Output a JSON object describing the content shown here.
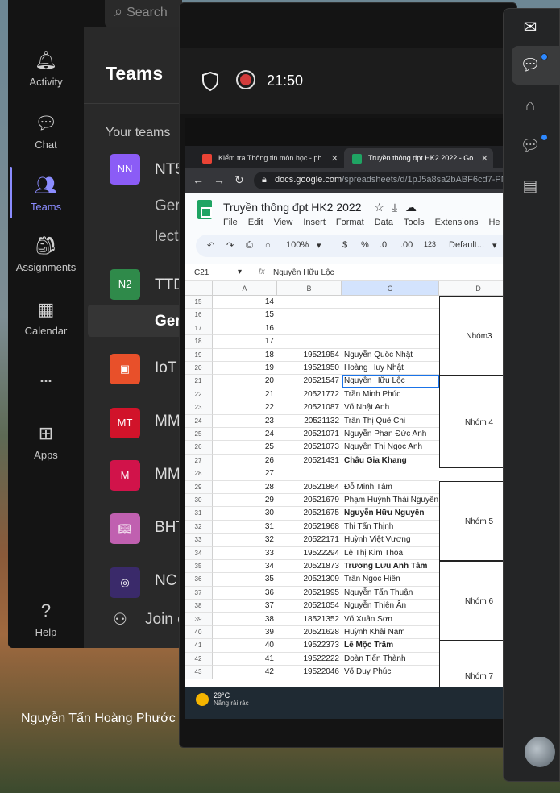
{
  "teams": {
    "nav": [
      {
        "label": "Activity",
        "icon": "bell-icon"
      },
      {
        "label": "Chat",
        "icon": "chat-icon"
      },
      {
        "label": "Teams",
        "icon": "people-icon"
      },
      {
        "label": "Assignments",
        "icon": "backpack-icon"
      },
      {
        "label": "Calendar",
        "icon": "calendar-icon"
      },
      {
        "label": "...",
        "icon": "more-icon"
      },
      {
        "label": "Apps",
        "icon": "apps-icon"
      },
      {
        "label": "Help",
        "icon": "help-icon"
      }
    ],
    "search_placeholder": "Search",
    "title": "Teams",
    "your_teams": "Your teams",
    "list": [
      {
        "avatar": "NN",
        "name": "NT5",
        "color": "#8b5cf6"
      },
      {
        "avatar": "N2",
        "name": "TTD",
        "color": "#2f8a4a"
      },
      {
        "avatar": "",
        "name": "IoT",
        "color": "#e8502a"
      },
      {
        "avatar": "MT",
        "name": "MM",
        "color": "#d1132a"
      },
      {
        "avatar": "M",
        "name": "MM",
        "color": "#d1134a"
      },
      {
        "avatar": "",
        "name": "BHT",
        "color": "#c060b0"
      },
      {
        "avatar": "",
        "name": "NC",
        "color": "#3a2a6a"
      }
    ],
    "subs": [
      "Ger",
      "lect",
      "Gen"
    ],
    "join": "Join o"
  },
  "call": {
    "time": "21:50",
    "participant": "Nguyễn Tấn Hoàng Phước"
  },
  "browser": {
    "tabs": [
      {
        "title": "Kiểm tra Thông tin môn học - ph",
        "color": "#ea4335"
      },
      {
        "title": "Truyền thông đpt HK2 2022 - Go",
        "color": "#1fa463"
      }
    ],
    "url_host": "docs.google.com",
    "url_path": "/spreadsheets/d/1pJ5a8sa2bABF6cd7-PN"
  },
  "sheet": {
    "title": "Truyền thông đpt HK2 2022",
    "menus": [
      "File",
      "Edit",
      "View",
      "Insert",
      "Format",
      "Data",
      "Tools",
      "Extensions",
      "He"
    ],
    "zoom": "100%",
    "font": "Default...",
    "cell_ref": "C21",
    "formula": "Nguyễn Hữu Lộc",
    "columns": [
      "A",
      "B",
      "C",
      "D"
    ],
    "rows": [
      {
        "n": "15",
        "a": "14",
        "b": "",
        "c": "",
        "bold": false
      },
      {
        "n": "16",
        "a": "15",
        "b": "",
        "c": "",
        "bold": false
      },
      {
        "n": "17",
        "a": "16",
        "b": "",
        "c": "",
        "bold": false
      },
      {
        "n": "18",
        "a": "17",
        "b": "",
        "c": "",
        "bold": false
      },
      {
        "n": "19",
        "a": "18",
        "b": "19521954",
        "c": "Nguyễn Quốc Nhật",
        "bold": false
      },
      {
        "n": "20",
        "a": "19",
        "b": "19521950",
        "c": "Hoàng Huy Nhật",
        "bold": false
      },
      {
        "n": "21",
        "a": "20",
        "b": "20521547",
        "c": "Nguyễn Hữu Lộc",
        "bold": false
      },
      {
        "n": "22",
        "a": "21",
        "b": "20521772",
        "c": "Trần Minh Phúc",
        "bold": false
      },
      {
        "n": "23",
        "a": "22",
        "b": "20521087",
        "c": "Võ Nhật Anh",
        "bold": false
      },
      {
        "n": "24",
        "a": "23",
        "b": "20521132",
        "c": "Trần Thị Quế Chi",
        "bold": false
      },
      {
        "n": "25",
        "a": "24",
        "b": "20521071",
        "c": "Nguyễn Phan Đức Anh",
        "bold": false
      },
      {
        "n": "26",
        "a": "25",
        "b": "20521073",
        "c": "Nguyễn Thị Ngọc Anh",
        "bold": false
      },
      {
        "n": "27",
        "a": "26",
        "b": "20521431",
        "c": "Châu Gia Khang",
        "bold": true
      },
      {
        "n": "28",
        "a": "27",
        "b": "",
        "c": "",
        "bold": false
      },
      {
        "n": "29",
        "a": "28",
        "b": "20521864",
        "c": "Đỗ Minh Tâm",
        "bold": false
      },
      {
        "n": "30",
        "a": "29",
        "b": "20521679",
        "c": "Phạm Huỳnh Thái Nguyên",
        "bold": false
      },
      {
        "n": "31",
        "a": "30",
        "b": "20521675",
        "c": "Nguyễn Hữu Nguyên",
        "bold": true
      },
      {
        "n": "32",
        "a": "31",
        "b": "20521968",
        "c": "Thi Tấn Thịnh",
        "bold": false
      },
      {
        "n": "33",
        "a": "32",
        "b": "20522171",
        "c": "Huỳnh Việt Vương",
        "bold": false
      },
      {
        "n": "34",
        "a": "33",
        "b": "19522294",
        "c": "Lê Thị Kim Thoa",
        "bold": false
      },
      {
        "n": "35",
        "a": "34",
        "b": "20521873",
        "c": "Trương Lưu Anh Tâm",
        "bold": true
      },
      {
        "n": "36",
        "a": "35",
        "b": "20521309",
        "c": "Trần Ngọc Hiền",
        "bold": false
      },
      {
        "n": "37",
        "a": "36",
        "b": "20521995",
        "c": "Nguyễn Tấn Thuận",
        "bold": false
      },
      {
        "n": "38",
        "a": "37",
        "b": "20521054",
        "c": "Nguyễn Thiên Ân",
        "bold": false
      },
      {
        "n": "39",
        "a": "38",
        "b": "18521352",
        "c": "Võ Xuân Sơn",
        "bold": false
      },
      {
        "n": "40",
        "a": "39",
        "b": "20521628",
        "c": "Huỳnh Khải Nam",
        "bold": false
      },
      {
        "n": "41",
        "a": "40",
        "b": "19522373",
        "c": "Lê Mộc Trâm",
        "bold": true
      },
      {
        "n": "42",
        "a": "41",
        "b": "19522222",
        "c": "Đoàn Tiến Thành",
        "bold": false
      },
      {
        "n": "43",
        "a": "42",
        "b": "19522046",
        "c": "Võ Duy Phúc",
        "bold": false
      }
    ],
    "groups": [
      {
        "label": "Nhóm3"
      },
      {
        "label": "Nhóm 4"
      },
      {
        "label": "Nhóm 5"
      },
      {
        "label": "Nhóm 6"
      },
      {
        "label": "Nhóm 7"
      }
    ]
  },
  "weather": {
    "temp": "29°C",
    "desc": "Nắng rải rác"
  }
}
